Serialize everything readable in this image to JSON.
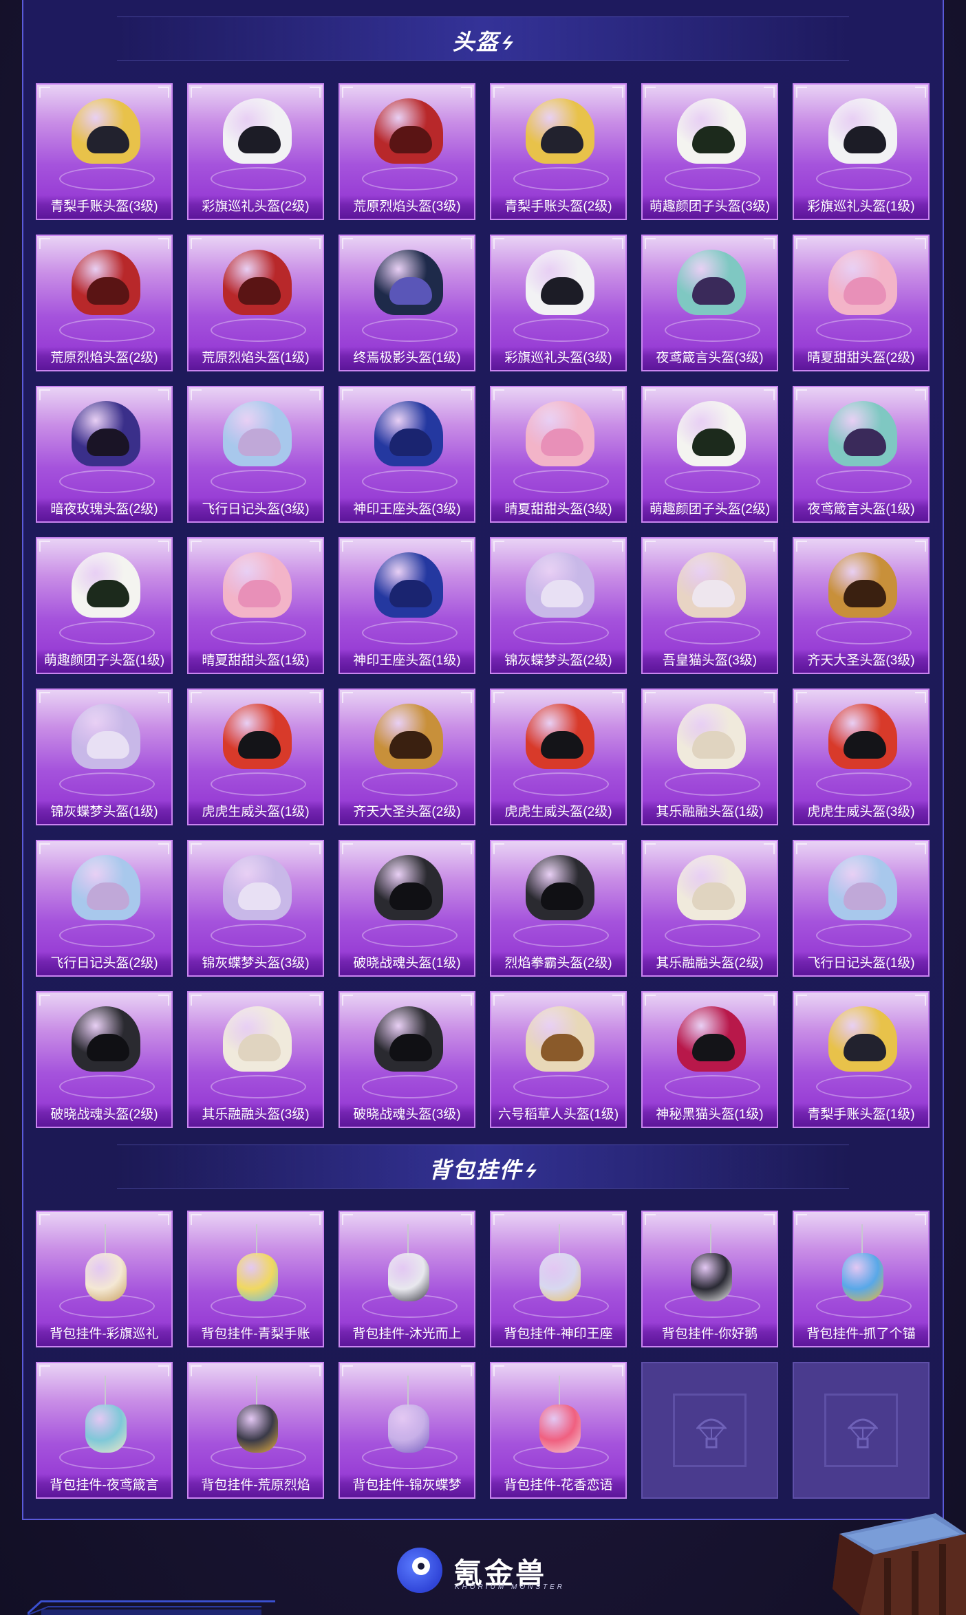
{
  "sections": {
    "helmets": {
      "title": "头盔"
    },
    "pendants": {
      "title": "背包挂件"
    }
  },
  "helmets": [
    {
      "label": "青梨手账头盔(3级)",
      "color": "#e8c24a",
      "visor": "#22222e"
    },
    {
      "label": "彩旗巡礼头盔(2级)",
      "color": "#f2f2f4",
      "visor": "#1c1c26"
    },
    {
      "label": "荒原烈焰头盔(3级)",
      "color": "#b8282a",
      "visor": "#5a1414"
    },
    {
      "label": "青梨手账头盔(2级)",
      "color": "#e8c24a",
      "visor": "#22222e"
    },
    {
      "label": "萌趣颜团子头盔(3级)",
      "color": "#f4f4f0",
      "visor": "#1c2a1c"
    },
    {
      "label": "彩旗巡礼头盔(1级)",
      "color": "#f2f2f4",
      "visor": "#1c1c26"
    },
    {
      "label": "荒原烈焰头盔(2级)",
      "color": "#b8282a",
      "visor": "#5a1414"
    },
    {
      "label": "荒原烈焰头盔(1级)",
      "color": "#b8282a",
      "visor": "#5a1414"
    },
    {
      "label": "终焉极影头盔(1级)",
      "color": "#1e2a4a",
      "visor": "#5a56b8"
    },
    {
      "label": "彩旗巡礼头盔(3级)",
      "color": "#f2f2f4",
      "visor": "#1c1c26"
    },
    {
      "label": "夜鸢箴言头盔(3级)",
      "color": "#7fc8c2",
      "visor": "#3a2a5a"
    },
    {
      "label": "晴夏甜甜头盔(2级)",
      "color": "#f3b4c8",
      "visor": "#e890b8"
    },
    {
      "label": "暗夜玫瑰头盔(2级)",
      "color": "#3a2f8a",
      "visor": "#1a1426"
    },
    {
      "label": "飞行日记头盔(3级)",
      "color": "#a8c8ec",
      "visor": "#c0a8d8"
    },
    {
      "label": "神印王座头盔(3级)",
      "color": "#2438a0",
      "visor": "#1a2470"
    },
    {
      "label": "晴夏甜甜头盔(3级)",
      "color": "#f3b4c8",
      "visor": "#e890b8"
    },
    {
      "label": "萌趣颜团子头盔(2级)",
      "color": "#f4f4f0",
      "visor": "#1c2a1c"
    },
    {
      "label": "夜鸢箴言头盔(1级)",
      "color": "#7fc8c2",
      "visor": "#3a2a5a"
    },
    {
      "label": "萌趣颜团子头盔(1级)",
      "color": "#f4f4f0",
      "visor": "#1c2a1c"
    },
    {
      "label": "晴夏甜甜头盔(1级)",
      "color": "#f3b4c8",
      "visor": "#e890b8"
    },
    {
      "label": "神印王座头盔(1级)",
      "color": "#2438a0",
      "visor": "#1a2470"
    },
    {
      "label": "锦灰蝶梦头盔(2级)",
      "color": "#c8b8e8",
      "visor": "#e8e0f4"
    },
    {
      "label": "吾皇猫头盔(3级)",
      "color": "#e8d4c4",
      "visor": "#eee6ee"
    },
    {
      "label": "齐天大圣头盔(3级)",
      "color": "#c8903a",
      "visor": "#3a2010"
    },
    {
      "label": "锦灰蝶梦头盔(1级)",
      "color": "#c8b8e8",
      "visor": "#e8e0f4"
    },
    {
      "label": "虎虎生威头盔(1级)",
      "color": "#d83a2a",
      "visor": "#141418"
    },
    {
      "label": "齐天大圣头盔(2级)",
      "color": "#c8903a",
      "visor": "#3a2010"
    },
    {
      "label": "虎虎生威头盔(2级)",
      "color": "#d83a2a",
      "visor": "#141418"
    },
    {
      "label": "其乐融融头盔(1级)",
      "color": "#f0eadc",
      "visor": "#e0d4c0"
    },
    {
      "label": "虎虎生威头盔(3级)",
      "color": "#d83a2a",
      "visor": "#141418"
    },
    {
      "label": "飞行日记头盔(2级)",
      "color": "#a8c8ec",
      "visor": "#c0a8d8"
    },
    {
      "label": "锦灰蝶梦头盔(3级)",
      "color": "#c8b8e8",
      "visor": "#e8e0f4"
    },
    {
      "label": "破晓战魂头盔(1级)",
      "color": "#2a2a30",
      "visor": "#101014"
    },
    {
      "label": "烈焰拳霸头盔(2级)",
      "color": "#2a2a30",
      "visor": "#101014"
    },
    {
      "label": "其乐融融头盔(2级)",
      "color": "#f0eadc",
      "visor": "#e0d4c0"
    },
    {
      "label": "飞行日记头盔(1级)",
      "color": "#a8c8ec",
      "visor": "#c0a8d8"
    },
    {
      "label": "破晓战魂头盔(2级)",
      "color": "#2a2a30",
      "visor": "#101014"
    },
    {
      "label": "其乐融融头盔(3级)",
      "color": "#f0eadc",
      "visor": "#e0d4c0"
    },
    {
      "label": "破晓战魂头盔(3级)",
      "color": "#2a2a30",
      "visor": "#101014"
    },
    {
      "label": "六号稻草人头盔(1级)",
      "color": "#e8d8b8",
      "visor": "#8a5a2a"
    },
    {
      "label": "神秘黑猫头盔(1级)",
      "color": "#b8184a",
      "visor": "#141418"
    },
    {
      "label": "青梨手账头盔(1级)",
      "color": "#e8c24a",
      "visor": "#22222e"
    }
  ],
  "pendants": [
    {
      "label": "背包挂件-彩旗巡礼",
      "color": "#f4e8d4",
      "accent": "#c8a060"
    },
    {
      "label": "背包挂件-青梨手账",
      "color": "#f0d860",
      "accent": "#68b8e0"
    },
    {
      "label": "背包挂件-沐光而上",
      "color": "#e8e8ee",
      "accent": "#3a3a44"
    },
    {
      "label": "背包挂件-神印王座",
      "color": "#d8d8f0",
      "accent": "#e8c060"
    },
    {
      "label": "背包挂件-你好鹅",
      "color": "#2a2a34",
      "accent": "#f4f4f4"
    },
    {
      "label": "背包挂件-抓了个锚",
      "color": "#58a8e8",
      "accent": "#e8b840"
    },
    {
      "label": "背包挂件-夜鸢箴言",
      "color": "#7fc8d8",
      "accent": "#f0e8c8"
    },
    {
      "label": "背包挂件-荒原烈焰",
      "color": "#3a3a48",
      "accent": "#e8b040"
    },
    {
      "label": "背包挂件-锦灰蝶梦",
      "color": "#c8b0e8",
      "accent": "#7860c0"
    },
    {
      "label": "背包挂件-花香恋语",
      "color": "#f06080",
      "accent": "#f4d0d8"
    }
  ],
  "empty_slots": [
    {
      "icon": "parachute-crate-icon"
    },
    {
      "icon": "parachute-crate-icon"
    }
  ],
  "brand": {
    "name": "氪金兽",
    "subtitle": "KHORIUM MONSTER",
    "color": "#3a4ee0"
  }
}
